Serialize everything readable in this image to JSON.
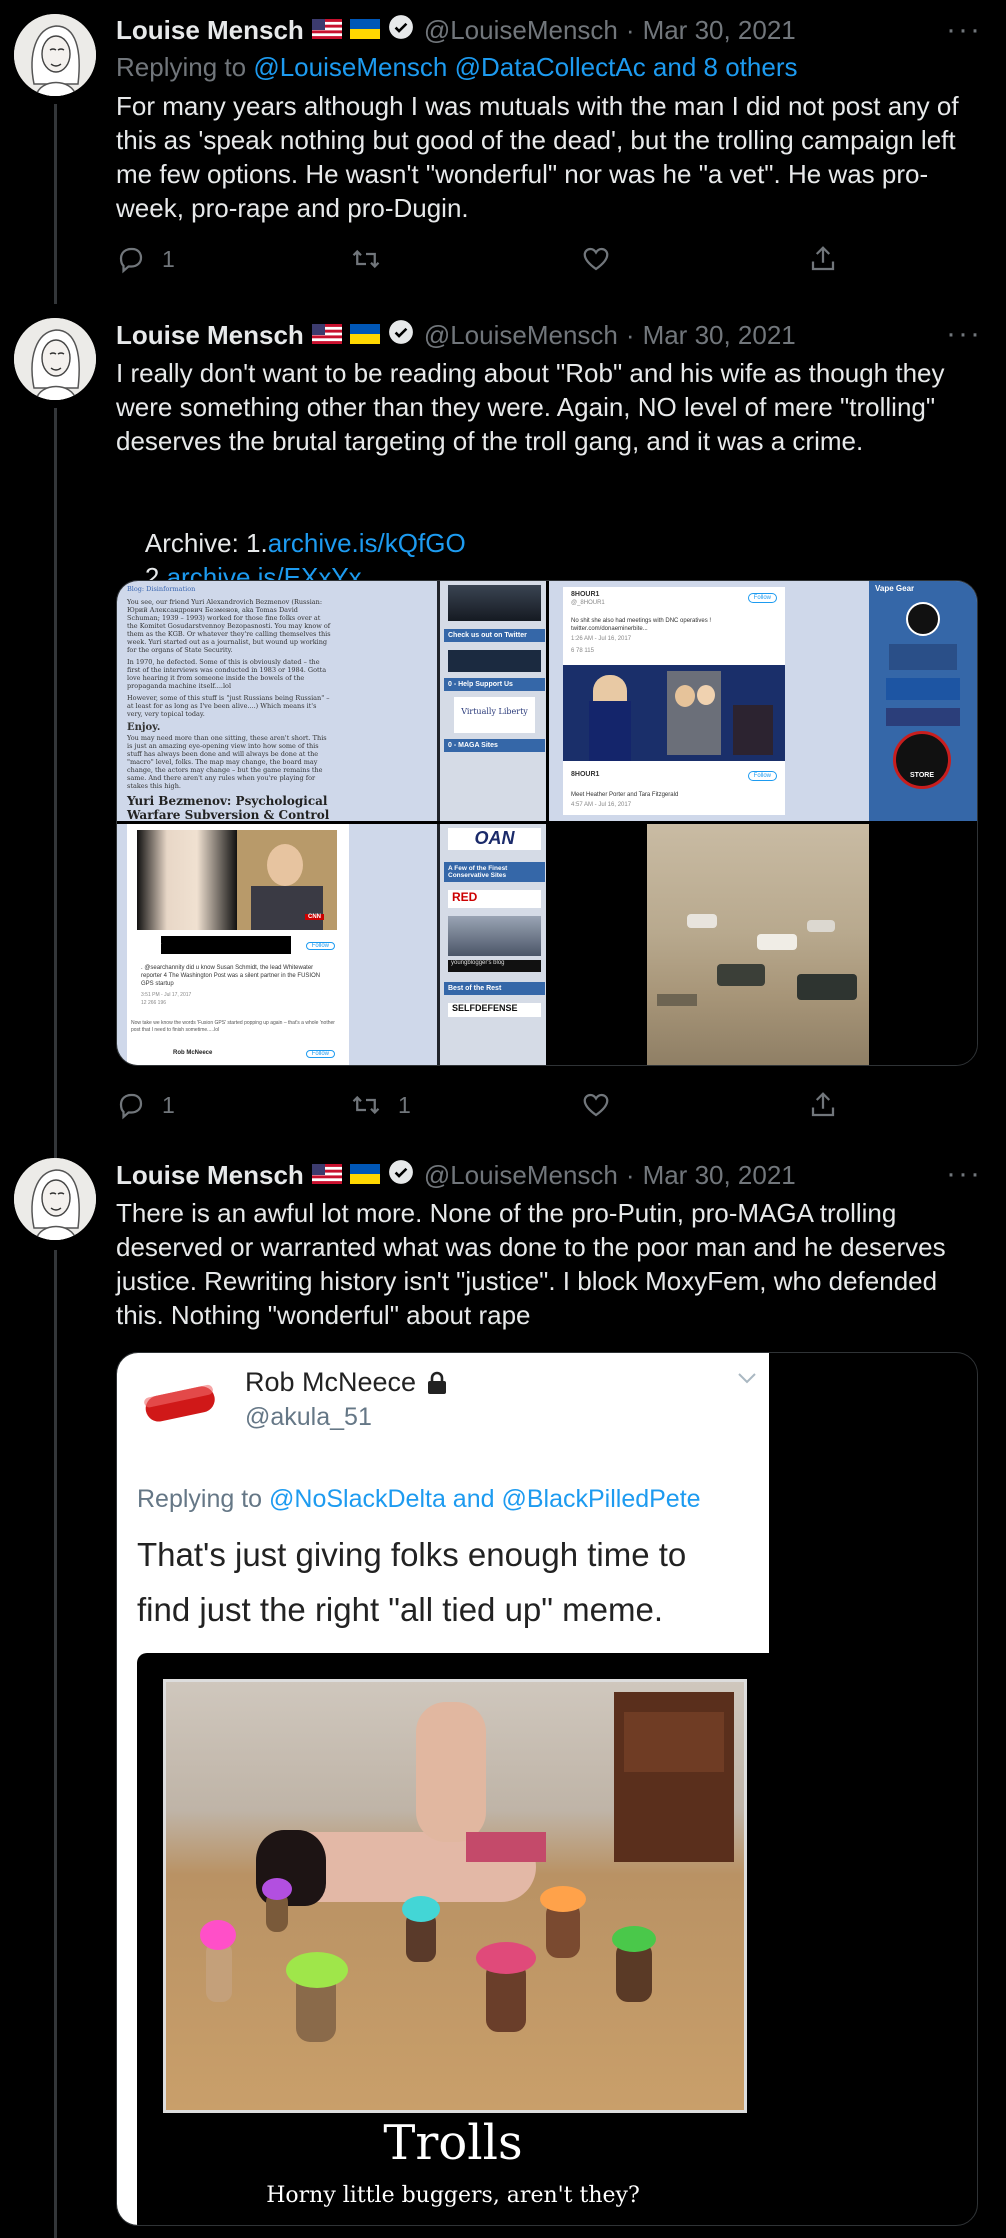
{
  "colors": {
    "background": "#000000",
    "text": "#e7e9ea",
    "muted": "#71767b",
    "link": "#1d9bf0"
  },
  "tweets": [
    {
      "name": "Louise Mensch",
      "handle": "@LouiseMensch",
      "sep": "·",
      "date": "Mar 30, 2021",
      "replying_prefix": "Replying to ",
      "replying_targets": "@LouiseMensch @DataCollectAc and 8 others",
      "text": "For many years although I was mutuals with the man I did not post any of this as 'speak nothing but good of the dead', but the trolling campaign left me few options. He wasn't \"wonderful\" nor was he \"a vet\". He was pro-week, pro-rape and pro-Dugin.",
      "reply_count": "1",
      "retweet_count": "",
      "like_count": ""
    },
    {
      "name": "Louise Mensch",
      "handle": "@LouiseMensch",
      "sep": "·",
      "date": "Mar 30, 2021",
      "text": "I really don't want to be reading about \"Rob\" and his wife as though they were something other than they were. Again, NO level of mere \"trolling\" deserves the brutal targeting of the troll gang, and it was a crime.",
      "archive_label": "Archive: 1.",
      "archive_link1": "archive.is/kQfGO",
      "archive_num2": "2.",
      "archive_link2": "archive.is/EXxYx",
      "reply_count": "1",
      "retweet_count": "1",
      "like_count": "",
      "media": {
        "img1": {
          "breadcrumb": "Blog: Disinformation",
          "para1": "You see, our friend Yuri Alexandrovich Bezmenov (Russian: Юрий Александрович Безменов, aka Tomas David Schuman; 1939 – 1993) worked for those fine folks over at the Komitet Gosudarstvennoy Bezopasnosti. You may know of them as the KGB. Or whatever they're calling themselves this week. Yuri started out as a journalist, but wound up working for the organs of State Security.",
          "para2": "In 1970, he defected. Some of this is obviously dated – the first of the interviews was conducted in 1983 or 1984. Gotta love hearing it from someone inside the bowels of the propaganda machine itself....lol",
          "para3": "However, some of this stuff is \"just Russians being Russian\" – at least for as long as I've been alive....) Which means it's very, very topical today.",
          "enjoy": "Enjoy.",
          "para4": "You may need more than one sitting, these aren't short. This is just an amazing eye-opening view into how some of this stuff has always been done and will always be done at the \"macro\" level, folks. The map may change, the board may change, the actors may change – but the game remains the same. And there aren't any rules when you're playing for stakes this high.",
          "heading": "Yuri Bezmenov: Psychological Warfare Subversion & Control of Western Society",
          "side1": "Check us out on Twitter",
          "side2": "0 - Help Support Us",
          "side3": "Virtually Liberty",
          "side4": "0 - MAGA Sites"
        },
        "img2": {
          "account": "8HOUR1",
          "account_handle": "@_8HOUR1",
          "follow": "Follow",
          "tweet_text": "No shit she also had meetings with DNC operatives !",
          "tweet_link": "twitter.com/donaeminerbite...",
          "time1": "1:26 AM - Jul 16, 2017",
          "stats1": "6   78   115",
          "caption": "Meet Heather Porter and Tara Fitzgerald",
          "time2": "4:57 AM - Jul 16, 2017",
          "sidebar_title": "Vape Gear",
          "store": "STORE"
        },
        "img3": {
          "oan": "OAN",
          "side_a": "A Few of the Finest Conservative Sites",
          "side_b": "RED",
          "side_c": "youngblogger's blog",
          "side_d": "Best of the Rest",
          "side_e": "SELFDEFENSE",
          "cnn": "CNN",
          "account": "8HOUR1",
          "follow": "Follow",
          "tweet_text": ". @searchannity did u know Susan Schmidt, the lead Whitewater reporter 4 The Washington Post was a silent partner in the FUSION GPS startup",
          "time": "3:51 PM - Jul 17, 2017",
          "stats": "12   266   196",
          "para": "Now take we know the words 'Fusion GPS' started popping up again – that's a whole 'nother post that I need to finish sometime.....lol",
          "footer_name": "Rob McNeece",
          "footer_follow": "Follow"
        }
      }
    },
    {
      "name": "Louise Mensch",
      "handle": "@LouiseMensch",
      "sep": "·",
      "date": "Mar 30, 2021",
      "text": "There is an awful lot more. None of the pro-Putin, pro-MAGA trolling deserved or warranted what was done to the poor man and he deserves justice. Rewriting history isn't \"justice\". I block MoxyFem, who defended this. Nothing \"wonderful\" about rape",
      "embed": {
        "name": "Rob McNeece",
        "handle": "@akula_51",
        "replying_prefix": "Replying to ",
        "replying_targets": "@NoSlackDelta and @BlackPilledPete",
        "text": "That's just giving folks enough time to find just the right \"all tied up\" meme.",
        "poster_title": "Trolls",
        "poster_caption": "Horny little buggers, aren't they?"
      }
    }
  ]
}
